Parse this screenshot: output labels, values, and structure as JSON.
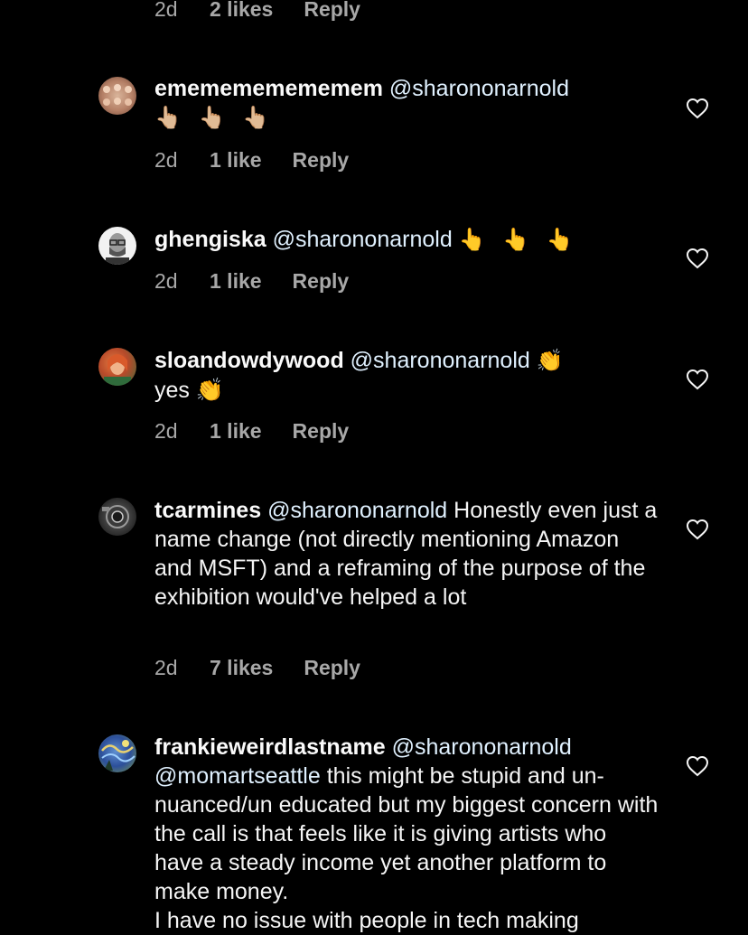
{
  "top_meta": {
    "time": "2d",
    "likes": "2 likes",
    "reply": "Reply"
  },
  "comments": [
    {
      "username": "ememememememem",
      "mention": "@sharononarnold",
      "text": "",
      "second_line": "👆🏼 👆🏼 👆🏼",
      "time": "2d",
      "likes": "1 like",
      "reply": "Reply"
    },
    {
      "username": "ghengiska",
      "mention": "@sharononarnold",
      "text": "👆 👆 👆",
      "time": "2d",
      "likes": "1 like",
      "reply": "Reply"
    },
    {
      "username": "sloandowdywood",
      "mention": "@sharononarnold",
      "text": "👏",
      "second_line": "yes 👏",
      "time": "2d",
      "likes": "1 like",
      "reply": "Reply"
    },
    {
      "username": "tcarmines",
      "mention": "@sharononarnold",
      "text": "Honestly even just a name change (not directly mentioning Amazon and MSFT) and a reframing of the purpose of the exhibition would've helped a lot",
      "time": "2d",
      "likes": "7 likes",
      "reply": "Reply"
    },
    {
      "username": "frankieweirdlastname",
      "mention": "@sharononarnold",
      "mention2": "@momartseattle",
      "text": "this might be stupid and un-nuanced/un educated but my biggest concern with the call is that feels like it is giving artists who have a steady income yet another platform to make money.",
      "text_cut": "I have no issue with people in tech making"
    }
  ],
  "colors": {
    "background": "#000000",
    "text": "#f5f5f5",
    "muted": "#a8a8a8"
  },
  "icons": {
    "like": "heart-outline-icon"
  }
}
